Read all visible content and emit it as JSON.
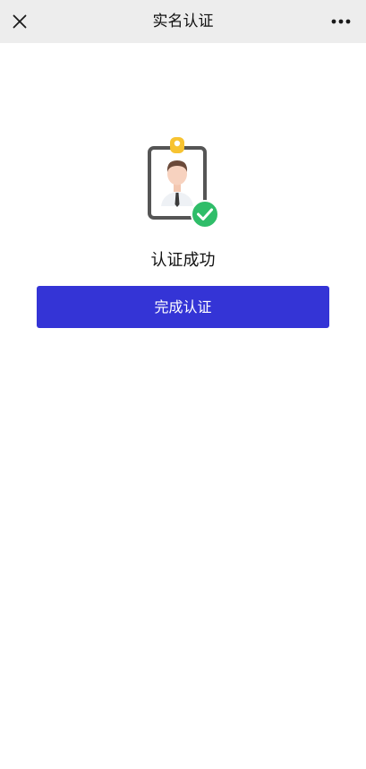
{
  "navbar": {
    "title": "实名认证",
    "close_icon": "close-icon",
    "more_icon": "more-icon"
  },
  "result": {
    "illustration": "id-badge-verified-icon",
    "status": "认证成功"
  },
  "actions": {
    "complete_label": "完成认证"
  },
  "colors": {
    "navbar_bg": "#ededed",
    "primary": "#3434d6",
    "success": "#2fbd69",
    "badge_clip": "#f7c331",
    "badge_frame": "#555555"
  }
}
